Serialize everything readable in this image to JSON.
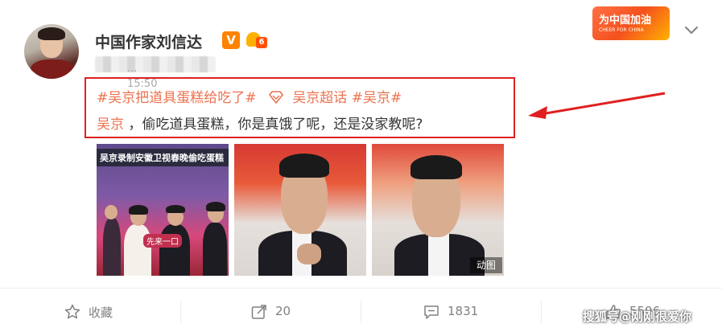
{
  "user": {
    "name": "中国作家刘信达",
    "verified_mark": "V",
    "vip_tag": "6",
    "time": "··· 15:50"
  },
  "promo": {
    "text": "为中国加油",
    "sub": "CHEER FOR CHINA"
  },
  "post": {
    "topic1": "#吴京把道具蛋糕给吃了#",
    "supertopic": "吴京超话",
    "topic2": "#吴京#",
    "mention": "吴京",
    "body": "，偷吃道具蛋糕，你是真饿了呢，还是没家教呢?"
  },
  "images": {
    "caption1": "吴京录制安徽卫视春晚偷吃蛋糕",
    "subtitle1": "先来一口",
    "gif_label": "动图"
  },
  "actions": {
    "favorite": "收藏",
    "repost": "20",
    "comment": "1831",
    "like": "5596"
  },
  "watermark": "搜狐号@刚刚很爱你",
  "colors": {
    "accent": "#eb7350",
    "highlight_border": "#e02020",
    "arrow": "#e02020"
  }
}
